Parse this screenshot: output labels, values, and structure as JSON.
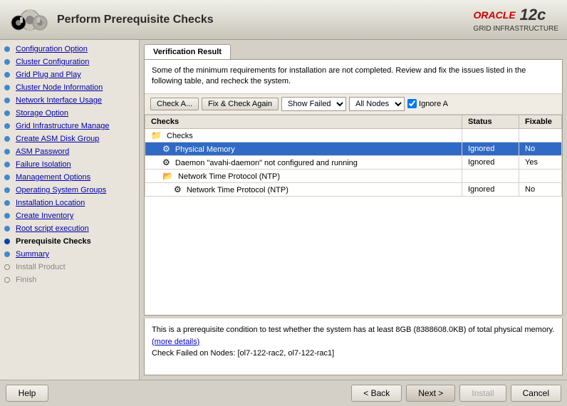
{
  "title": "Perform Prerequisite Checks",
  "oracle": {
    "text": "ORACLE",
    "product": "GRID INFRASTRUCTURE",
    "version": "12c"
  },
  "sidebar": {
    "items": [
      {
        "id": "config-option",
        "label": "Configuration Option",
        "state": "link"
      },
      {
        "id": "cluster-config",
        "label": "Cluster Configuration",
        "state": "link"
      },
      {
        "id": "grid-plug-play",
        "label": "Grid Plug and Play",
        "state": "link"
      },
      {
        "id": "cluster-node-info",
        "label": "Cluster Node Information",
        "state": "link"
      },
      {
        "id": "network-interface",
        "label": "Network Interface Usage",
        "state": "link"
      },
      {
        "id": "storage-option",
        "label": "Storage Option",
        "state": "link"
      },
      {
        "id": "grid-infra-manage",
        "label": "Grid Infrastructure Manage",
        "state": "link"
      },
      {
        "id": "create-asm-disk",
        "label": "Create ASM Disk Group",
        "state": "link"
      },
      {
        "id": "asm-password",
        "label": "ASM Password",
        "state": "link"
      },
      {
        "id": "failure-isolation",
        "label": "Failure Isolation",
        "state": "link"
      },
      {
        "id": "management-options",
        "label": "Management Options",
        "state": "link"
      },
      {
        "id": "os-groups",
        "label": "Operating System Groups",
        "state": "link"
      },
      {
        "id": "install-location",
        "label": "Installation Location",
        "state": "link"
      },
      {
        "id": "create-inventory",
        "label": "Create Inventory",
        "state": "link"
      },
      {
        "id": "root-script",
        "label": "Root script execution",
        "state": "link"
      },
      {
        "id": "prereq-checks",
        "label": "Prerequisite Checks",
        "state": "active"
      },
      {
        "id": "summary",
        "label": "Summary",
        "state": "link"
      },
      {
        "id": "install-product",
        "label": "Install Product",
        "state": "disabled"
      },
      {
        "id": "finish",
        "label": "Finish",
        "state": "disabled"
      }
    ]
  },
  "tab": {
    "label": "Verification Result"
  },
  "panel": {
    "description": "Some of the minimum requirements for installation are not completed. Review and fix the issues listed in the following table, and recheck the system.",
    "toolbar": {
      "check_again": "Check A...",
      "fix_check": "Fix & Check Again",
      "show_failed": "Show Failed",
      "all_nodes": "All Nodes",
      "ignore_label": "Ignore A"
    },
    "table": {
      "columns": [
        "Checks",
        "Status",
        "Fixable"
      ],
      "rows": [
        {
          "type": "group",
          "indent": 0,
          "label": "Checks",
          "status": "",
          "fixable": ""
        },
        {
          "type": "item",
          "indent": 1,
          "label": "Physical Memory",
          "status": "Ignored",
          "fixable": "No",
          "selected": true
        },
        {
          "type": "item",
          "indent": 1,
          "label": "Daemon \"avahi-daemon\" not configured and running",
          "status": "Ignored",
          "fixable": "Yes",
          "selected": false
        },
        {
          "type": "group",
          "indent": 1,
          "label": "Network Time Protocol (NTP)",
          "status": "",
          "fixable": "",
          "selected": false
        },
        {
          "type": "item",
          "indent": 2,
          "label": "Network Time Protocol (NTP)",
          "status": "Ignored",
          "fixable": "No",
          "selected": false
        }
      ]
    }
  },
  "description_panel": {
    "text1": "This is a prerequisite condition to test whether the system has at least 8GB (8388608.0KB) of total physical memory.",
    "link": "(more details)",
    "text2": "Check Failed on Nodes: [ol7-122-rac2, ol7-122-rac1]"
  },
  "buttons": {
    "help": "Help",
    "back": "< Back",
    "next": "Next >",
    "install": "Install",
    "cancel": "Cancel"
  }
}
